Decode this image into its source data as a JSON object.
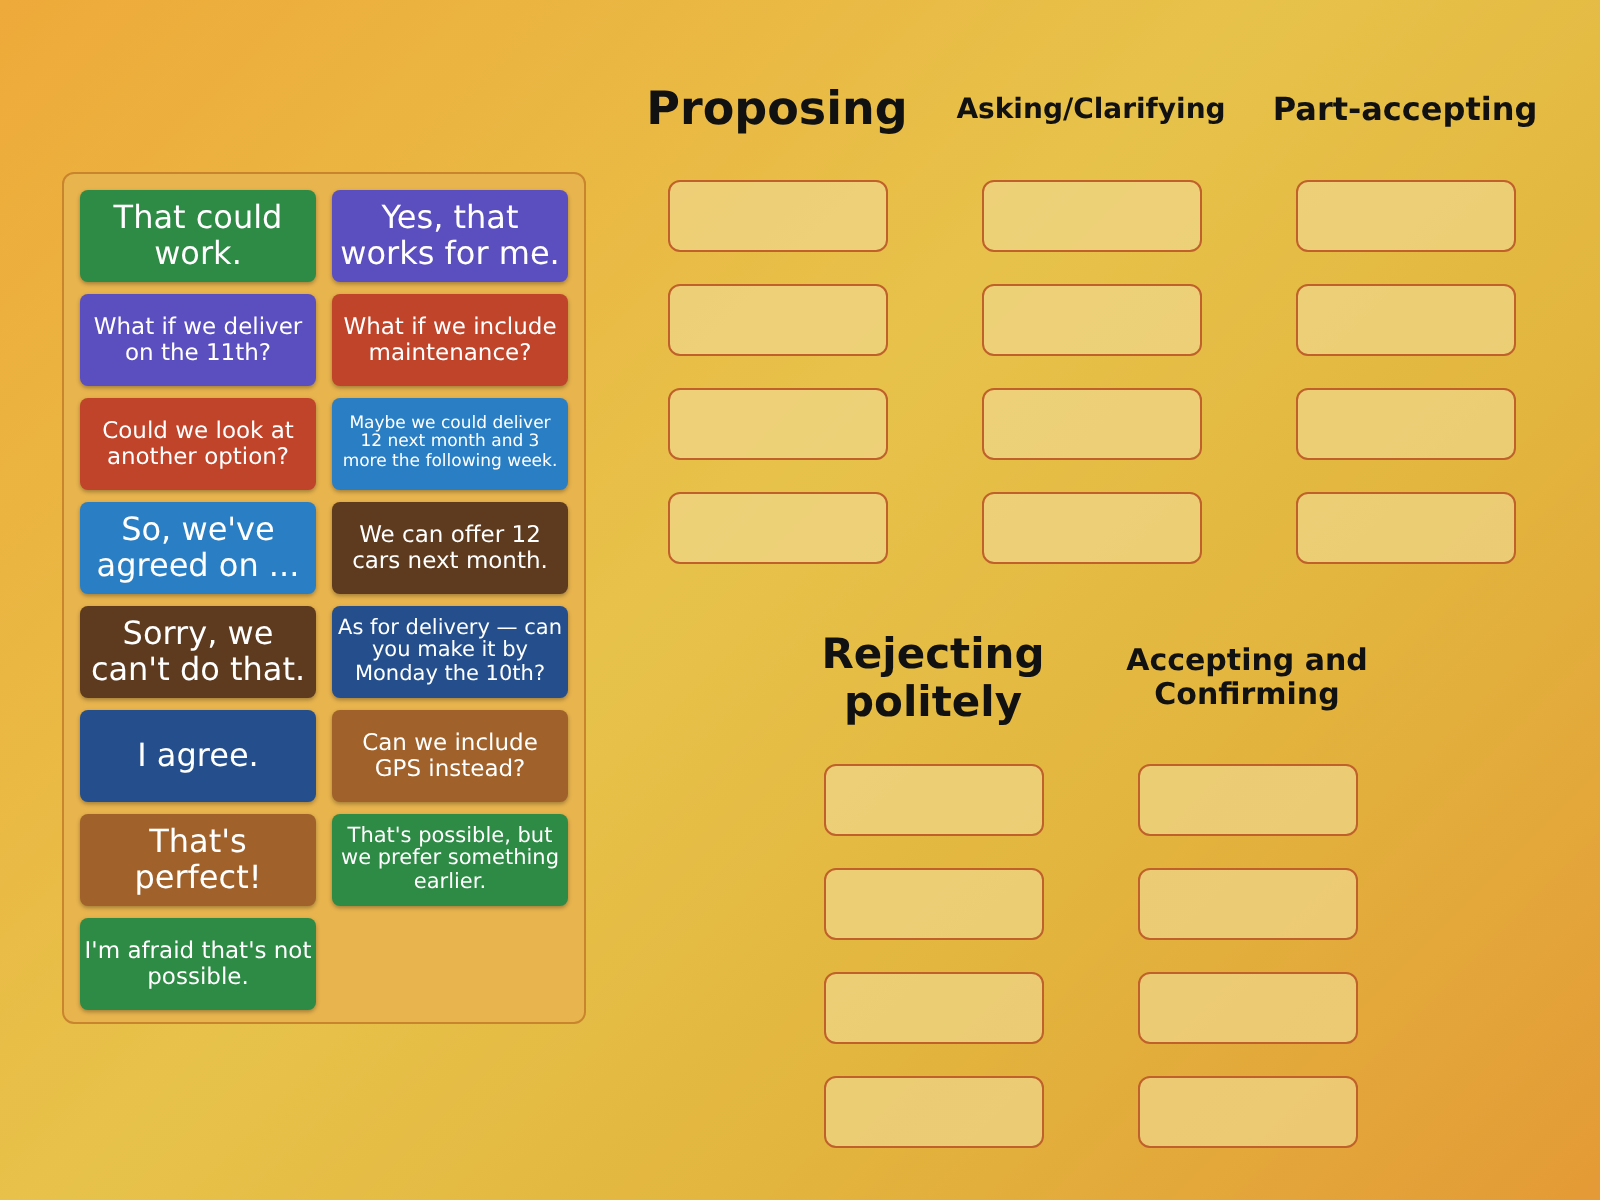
{
  "cards": [
    {
      "text": "That could work.",
      "color": "#2e8b45"
    },
    {
      "text": "Yes, that works for me.",
      "color": "#5b4fc0"
    },
    {
      "text": "What if we deliver on the 11th?",
      "color": "#5b4fc0"
    },
    {
      "text": "What if we include maintenance?",
      "color": "#c0442a"
    },
    {
      "text": "Could we look at another option?",
      "color": "#c0442a"
    },
    {
      "text": "Maybe we could deliver 12 next month and 3 more the following week.",
      "color": "#2a7fc4"
    },
    {
      "text": "So, we've agreed on ...",
      "color": "#2a7fc4"
    },
    {
      "text": "We can offer 12 cars next month.",
      "color": "#5e3a1e"
    },
    {
      "text": "Sorry, we can't do that.",
      "color": "#5e3a1e"
    },
    {
      "text": "As for delivery — can you make it by Monday the 10th?",
      "color": "#244f8c"
    },
    {
      "text": "I agree.",
      "color": "#244f8c"
    },
    {
      "text": "Can we include GPS instead?",
      "color": "#a0622a"
    },
    {
      "text": "That's perfect!",
      "color": "#a0622a"
    },
    {
      "text": "That's possible, but we prefer something earlier.",
      "color": "#2e8b45"
    },
    {
      "text": "I'm afraid that's not possible.",
      "color": "#2e8b45"
    }
  ],
  "groups": [
    {
      "title": "Proposing"
    },
    {
      "title": "Asking/Clarifying"
    },
    {
      "title": "Part-accepting"
    },
    {
      "title": "Rejecting politely"
    },
    {
      "title": "Accepting and Confirming"
    }
  ]
}
